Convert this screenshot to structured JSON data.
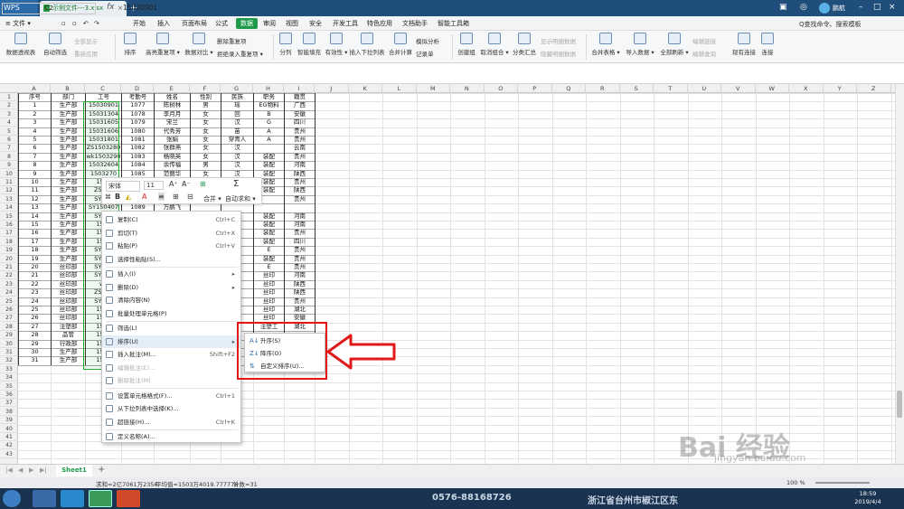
{
  "titlebar": {
    "app_tab": "WPS",
    "file_tab": "示例文件---3.xlsx",
    "user_name": "鹏航"
  },
  "menubar": {
    "file_menu": "≡ 文件 ▾",
    "items": [
      "开始",
      "插入",
      "页面布局",
      "公式",
      "数据",
      "审阅",
      "视图",
      "安全",
      "开发工具",
      "特色应用",
      "文档助手",
      "智能工具箱"
    ],
    "active": "数据",
    "search": "Q查找命令、搜索模板"
  },
  "ribbon": {
    "pivot": "数据透视表",
    "autofilter": "自动筛选",
    "show_all": "全部显示",
    "reapply": "重新应用",
    "sort": "排序",
    "highlight_dup": "高亮重复项 ▾",
    "data_compare": "数据对比 ▾",
    "remove_dup": "删除重复项",
    "reject_dup": "拒绝录入重复项 ▾",
    "split": "分列",
    "smart_fill": "智能填充",
    "validity": "有效性 ▾",
    "dropdown_list": "插入下拉列表",
    "consolidate": "合并计算",
    "simulate": "模拟分析",
    "record": "记录单",
    "create_group": "创建组",
    "ungroup": "取消组合 ▾",
    "subtotal": "分类汇总",
    "show_detail": "显示明细数据",
    "hide_detail": "隐藏明细数据",
    "merge_tables": "合并表格 ▾",
    "import_data": "导入数据 ▾",
    "refresh_all": "全部刷新 ▾",
    "edit_link": "编辑链接",
    "edit_query": "编辑查询",
    "existing_conn": "现有连接",
    "connect": "连接"
  },
  "formula_bar": {
    "cell_ref": "C2",
    "fx": "fx",
    "value": "15030901"
  },
  "grid": {
    "columns": [
      "A",
      "B",
      "C",
      "D",
      "E",
      "F",
      "G",
      "H",
      "I",
      "J",
      "K",
      "L",
      "M",
      "N",
      "O",
      "P",
      "Q",
      "R",
      "S",
      "T",
      "U",
      "V",
      "W",
      "X",
      "Y",
      "Z",
      "AA"
    ],
    "rows": [
      "1",
      "2",
      "3",
      "4",
      "5",
      "6",
      "7",
      "8",
      "9",
      "10",
      "11",
      "12",
      "13",
      "14",
      "15",
      "16",
      "17",
      "18",
      "19",
      "20",
      "21",
      "22",
      "23",
      "24",
      "25",
      "26",
      "27",
      "28",
      "29",
      "30",
      "31",
      "32",
      "33",
      "34",
      "35",
      "36",
      "37",
      "38",
      "39",
      "40",
      "41",
      "42",
      "43"
    ],
    "header": [
      "序号",
      "部门",
      "工号",
      "考勤号",
      "姓名",
      "性别",
      "民族",
      "职务",
      "籍贯"
    ],
    "col_A": [
      "1",
      "2",
      "3",
      "4",
      "5",
      "6",
      "7",
      "8",
      "9",
      "10",
      "11",
      "12",
      "13",
      "14",
      "15",
      "16",
      "17",
      "18",
      "19",
      "20",
      "21",
      "22",
      "23",
      "24",
      "25",
      "26",
      "27",
      "28",
      "29",
      "30",
      "31"
    ],
    "col_B": [
      "生产部",
      "生产部",
      "生产部",
      "生产部",
      "生产部",
      "生产部",
      "生产部",
      "生产部",
      "生产部",
      "生产部",
      "生产部",
      "生产部",
      "生产部",
      "生产部",
      "生产部",
      "生产部",
      "生产部",
      "生产部",
      "生产部",
      "丝印部",
      "丝印部",
      "丝印部",
      "丝印部",
      "丝印部",
      "丝印部",
      "丝印部",
      "注塑部",
      "品管",
      "行政部",
      "生产部",
      "生产部"
    ],
    "col_C": [
      "15030901",
      "15031304",
      "15031605",
      "15031606",
      "15031801",
      "ZS1503280",
      "wk1503290",
      "15032604",
      "1503270",
      "1503",
      "ZS150",
      "SY150",
      "SY150407",
      "SY150",
      "1504",
      "1504",
      "1504",
      "SY150",
      "SY150",
      "SY150",
      "SY150",
      "wk",
      "ZS150",
      "SY150",
      "1503",
      "1503",
      "1503",
      "1503",
      "1503",
      "1503",
      "1503"
    ],
    "col_D": [
      "1077",
      "1078",
      "1079",
      "1080",
      "1081",
      "1082",
      "1083",
      "1084",
      "1085",
      "",
      "",
      "",
      "1089",
      "",
      "",
      "",
      "",
      "",
      "",
      "",
      "",
      "",
      "",
      "",
      "",
      "",
      "",
      "",
      "",
      "",
      ""
    ],
    "col_E": [
      "陈树林",
      "李月月",
      "宋兰",
      "代秀芳",
      "张娟",
      "张群燕",
      "杨晓英",
      "余传福",
      "范丽华",
      "",
      "",
      "",
      "万鹏飞",
      "",
      "",
      "",
      "",
      "",
      "",
      "",
      "",
      "",
      "",
      "",
      "",
      "",
      "",
      "",
      "",
      "",
      ""
    ],
    "col_F": [
      "男",
      "女",
      "女",
      "女",
      "女",
      "女",
      "女",
      "男",
      "女",
      "",
      "",
      "",
      "",
      "",
      "",
      "",
      "",
      "",
      "",
      "",
      "",
      "",
      "",
      "",
      "",
      "",
      "",
      "",
      "",
      "",
      ""
    ],
    "col_G": [
      "瑶",
      "回",
      "汉",
      "苗",
      "穿青人",
      "汉",
      "汉",
      "汉",
      "汉",
      "",
      "",
      "",
      "",
      "",
      "",
      "",
      "",
      "",
      "",
      "",
      "",
      "",
      "",
      "",
      "",
      "",
      "",
      "",
      "",
      "",
      ""
    ],
    "col_H": [
      "EG物料",
      "B",
      "G",
      "A",
      "A",
      "",
      "装配",
      "装配",
      "装配",
      "装配",
      "装配",
      "",
      "",
      "装配",
      "装配",
      "装配",
      "装配",
      "E",
      "装配",
      "E",
      "丝印",
      "丝印",
      "丝印",
      "丝印",
      "丝印",
      "丝印",
      "注塑工",
      "",
      "",
      "",
      ""
    ],
    "col_I": [
      "广西",
      "安徽",
      "四川",
      "贵州",
      "贵州",
      "云南",
      "贵州",
      "河南",
      "陕西",
      "贵州",
      "陕西",
      "贵州",
      "",
      "河南",
      "河南",
      "贵州",
      "四川",
      "贵州",
      "贵州",
      "贵州",
      "河南",
      "陕西",
      "陕西",
      "贵州",
      "湖北",
      "安徽",
      "湖北",
      "",
      "",
      "",
      ""
    ]
  },
  "mini_toolbar": {
    "font": "宋体",
    "size": "11",
    "merge": "合并 ▾",
    "autosum": "自动求和 ▾"
  },
  "context_menu": {
    "items": [
      {
        "label": "复制(C)",
        "shortcut": "Ctrl+C"
      },
      {
        "label": "剪切(T)",
        "shortcut": "Ctrl+X"
      },
      {
        "label": "粘贴(P)",
        "shortcut": "Ctrl+V"
      },
      {
        "label": "选择性粘贴(S)...",
        "shortcut": ""
      },
      {
        "label": "插入(I)",
        "shortcut": ""
      },
      {
        "label": "删除(D)",
        "shortcut": ""
      },
      {
        "label": "清除内容(N)",
        "shortcut": ""
      },
      {
        "label": "批量处理单元格(P)",
        "shortcut": ""
      },
      {
        "label": "筛选(L)",
        "shortcut": ""
      },
      {
        "label": "排序(U)",
        "shortcut": ""
      },
      {
        "label": "插入批注(M)...",
        "shortcut": "Shift+F2"
      },
      {
        "label": "编辑批注(E)...",
        "shortcut": ""
      },
      {
        "label": "删除批注(M)",
        "shortcut": ""
      },
      {
        "label": "设置单元格格式(F)...",
        "shortcut": "Ctrl+1"
      },
      {
        "label": "从下拉列表中选择(K)...",
        "shortcut": ""
      },
      {
        "label": "超链接(H)...",
        "shortcut": "Ctrl+K"
      },
      {
        "label": "定义名称(A)...",
        "shortcut": ""
      }
    ]
  },
  "sort_submenu": {
    "items": [
      "升序(S)",
      "降序(O)",
      "自定义排序(U)..."
    ]
  },
  "sheet_tabs": {
    "sheet1": "Sheet1"
  },
  "status_bar": {
    "sum": "求和=2亿7061万2356",
    "average": "平均值=1503万4019.777778",
    "count": "计数=31",
    "zoom": "100 %"
  },
  "taskbar": {
    "time": "18:59",
    "date": "2019/4/4",
    "banner_phone": "0576-88168726",
    "banner_text": "浙江省台州市椒江区东"
  },
  "watermark": {
    "brand": "Bai 经验",
    "url": "jingyan.baidu.com"
  },
  "colors": {
    "accent": "#1e9a4a",
    "title_bar": "#1f4e7a",
    "highlight_red": "#e01818"
  }
}
